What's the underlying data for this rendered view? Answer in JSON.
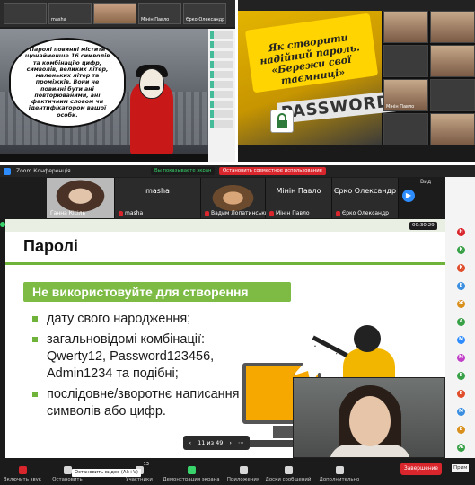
{
  "top_left": {
    "tiles": [
      {
        "name": ""
      },
      {
        "name": "masha"
      },
      {
        "name": ""
      },
      {
        "name": "Мінін Павло"
      },
      {
        "name": "Єрко Олександр"
      }
    ],
    "bubble_text": "Паролі повинні містити щонайменше 16 символів та комбінацію цифр, символів, великих літер, маленьких літер та проміжків. Вони не повинні бути ані повторюваними, ані фактичним словом чи ідентифікатором вашої особи."
  },
  "top_right": {
    "slide_text": "Як створити надійний пароль. «Бережи свої таємниці»",
    "password_word": "PASSWORD",
    "tiles": [
      {
        "name": ""
      },
      {
        "name": ""
      },
      {
        "name": ""
      },
      {
        "name": ""
      },
      {
        "name": "Мінін Павло"
      },
      {
        "name": ""
      },
      {
        "name": ""
      },
      {
        "name": ""
      }
    ]
  },
  "window": {
    "app_title": "Zoom Конференція",
    "sharing_status": "Вы показываете экран",
    "stop_share": "Остановить совместное использование",
    "view_label": "Вид",
    "share_tag": "00:30:29"
  },
  "participants": [
    {
      "label": "Ганна Кісіль",
      "muted": false
    },
    {
      "label": "masha",
      "muted": true,
      "top_name": "masha"
    },
    {
      "label": "Вадим Лопатинський",
      "muted": true
    },
    {
      "label": "Мінін Павло",
      "muted": true,
      "top_name": "Мінін Павло"
    },
    {
      "label": "Єрко Олександр",
      "muted": true,
      "top_name": "Єрко Олександр"
    }
  ],
  "slide": {
    "title": "Паролі",
    "banner": "Не використовуйте для створення паролів:",
    "bullets": [
      "дату свого народження;",
      "загальновідомі комбінації: Qwerty12, Password123456, Admin1234 та подібні;",
      "послідовне/зворотнє написання символів або цифр."
    ],
    "pager": "11 из 49"
  },
  "chat_panel": {
    "avatars": [
      {
        "letter": "Н",
        "color": "#d9262c"
      },
      {
        "letter": "К",
        "color": "#38a047"
      },
      {
        "letter": "К",
        "color": "#e04d2b"
      },
      {
        "letter": "В",
        "color": "#3b8fe0"
      },
      {
        "letter": "Ж",
        "color": "#d98f1b"
      },
      {
        "letter": "А",
        "color": "#38a047"
      },
      {
        "letter": "М",
        "color": "#2d8cff"
      },
      {
        "letter": "М",
        "color": "#c23fc8"
      },
      {
        "letter": "Б",
        "color": "#38a047"
      },
      {
        "letter": "Б",
        "color": "#e04d2b"
      },
      {
        "letter": "М",
        "color": "#3b8fe0"
      },
      {
        "letter": "В",
        "color": "#d98f1b"
      },
      {
        "letter": "Ж",
        "color": "#38a047"
      }
    ]
  },
  "toolbar": {
    "items": [
      {
        "label": "Включить звук",
        "icon": "microphone-icon",
        "color": "red"
      },
      {
        "label": "Остановить",
        "icon": "video-camera-icon",
        "color": "grey"
      },
      {
        "label": "Участники",
        "icon": "participants-icon",
        "color": "grey",
        "count": "13"
      },
      {
        "label": "Демонстрация экрана",
        "icon": "share-screen-icon",
        "color": "green"
      },
      {
        "label": "Приложения",
        "icon": "apps-icon",
        "color": "grey"
      },
      {
        "label": "Доски сообщений",
        "icon": "whiteboard-icon",
        "color": "grey"
      },
      {
        "label": "Дополнительно",
        "icon": "more-icon",
        "color": "grey"
      }
    ],
    "tooltip": "Остановить видео (Alt+V)",
    "end_label": "Завершение",
    "edge_label": "Прим"
  }
}
